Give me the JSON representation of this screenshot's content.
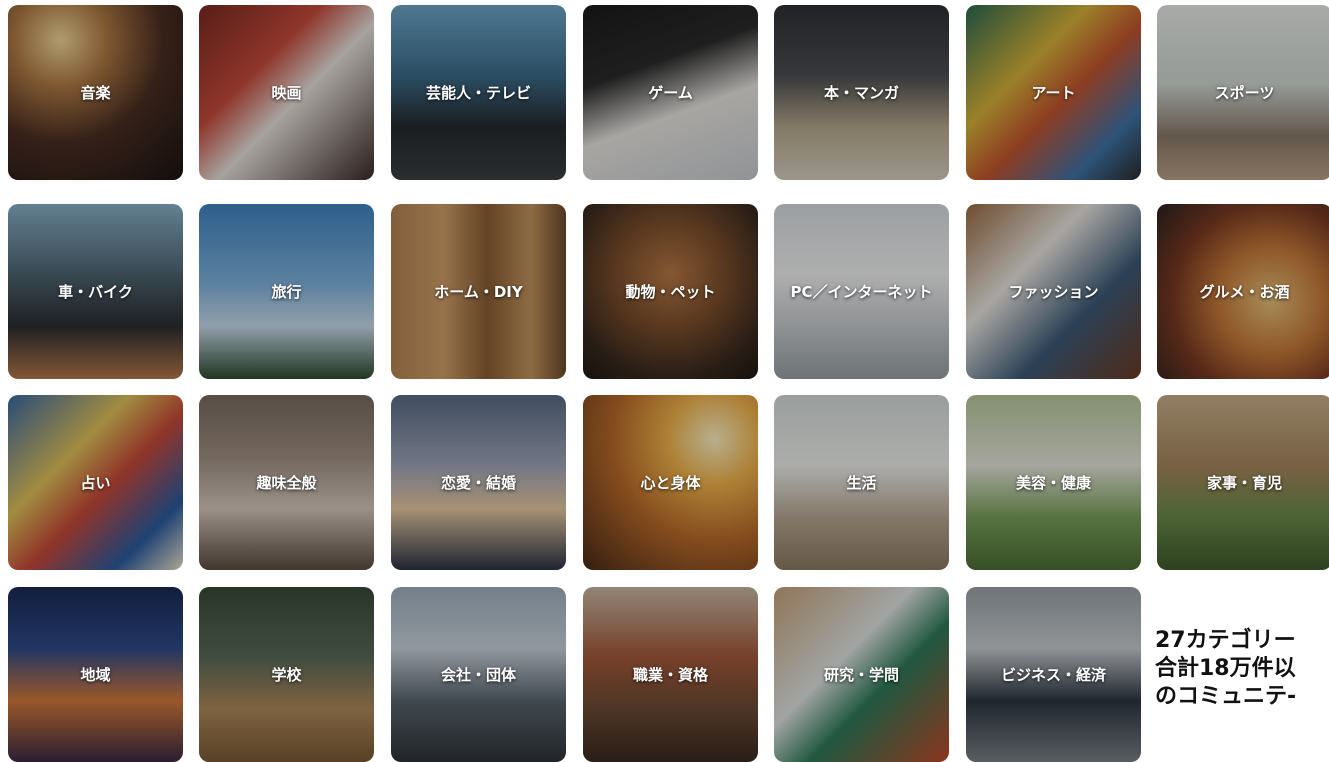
{
  "categories": [
    {
      "label": "音楽",
      "bg": "radial-gradient(circle at 30% 20%, #f3d89a 0%, #b07a45 25%, #4a2e22 55%, #1a1412 100%)"
    },
    {
      "label": "映画",
      "bg": "linear-gradient(135deg, #7a2a22 0%, #c64a3a 35%, #e8e2dc 55%, #3b2a26 100%)"
    },
    {
      "label": "芸能人・テレビ",
      "bg": "linear-gradient(180deg, #6ea7c9 0%, #3d6d8c 40%, #262a2e 70%, #3c3f42 100%)"
    },
    {
      "label": "ゲーム",
      "bg": "linear-gradient(160deg, #1b1b1b 0%, #2b2b2b 35%, #e8e6e2 60%, #c9ccd0 100%)"
    },
    {
      "label": "本・マンガ",
      "bg": "linear-gradient(180deg, #2e3034 0%, #4b4e52 40%, #b9a98c 70%, #d7d0c4 100%)"
    },
    {
      "label": "アート",
      "bg": "linear-gradient(135deg, #2a6b52 0%, #d7b33a 35%, #c5552f 55%, #3f73a7 80%, #2b2b2b 100%)"
    },
    {
      "label": "スポーツ",
      "bg": "linear-gradient(180deg, #e9ece9 0%, #cfd7d2 45%, #8a7a6a 75%, #bda38a 100%)"
    },
    {
      "label": "車・バイク",
      "bg": "linear-gradient(180deg, #8bb2c9 0%, #4f6673 40%, #2c2d30 70%, #b77a4b 100%)"
    },
    {
      "label": "旅行",
      "bg": "linear-gradient(180deg, #3f84c2 0%, #7fb3dd 45%, #c9dcec 70%, #2d4c2f 100%)"
    },
    {
      "label": "ホーム・DIY",
      "bg": "linear-gradient(90deg, #b58553 0%, #d2a06a 30%, #8a5e35 55%, #c4965f 80%, #6d4a2b 100%)"
    },
    {
      "label": "動物・ペット",
      "bg": "radial-gradient(circle at 50% 40%, #b87a45 0%, #7b4e2c 40%, #3a2a1f 75%, #1e1813 100%)"
    },
    {
      "label": "PC／インターネット",
      "bg": "linear-gradient(180deg, #d9dde0 0%, #f2f2f2 40%, #c6cacd 70%, #98a0a5 100%)"
    },
    {
      "label": "ファッション",
      "bg": "linear-gradient(135deg, #9b6b42 0%, #e9e6e0 35%, #3d5b78 65%, #6d3b22 100%)"
    },
    {
      "label": "グルメ・お酒",
      "bg": "radial-gradient(circle at 65% 55%, #e8c27a 0%, #c77a3a 35%, #7a3a22 65%, #2b2220 100%)"
    },
    {
      "label": "占い",
      "bg": "linear-gradient(135deg, #3b6aa8 0%, #e0c25a 35%, #c84a3a 55%, #2b5ca0 80%, #efe6cf 100%)"
    },
    {
      "label": "趣味全般",
      "bg": "linear-gradient(180deg, #7a6b60 0%, #a08f82 35%, #d6c9bd 65%, #5b4b40 100%)"
    },
    {
      "label": "恋愛・結婚",
      "bg": "linear-gradient(180deg, #5a6c86 0%, #9fa5b8 40%, #e6c9a2 65%, #2b3446 100%)"
    },
    {
      "label": "心と身体",
      "bg": "radial-gradient(circle at 75% 25%, #fff2c4 0%, #f0b24a 25%, #b86a2a 55%, #4a2a18 100%)"
    },
    {
      "label": "生活",
      "bg": "linear-gradient(180deg, #d7dcd9 0%, #eef0ee 40%, #b8a792 70%, #8c7a65 100%)"
    },
    {
      "label": "美容・健康",
      "bg": "linear-gradient(180deg, #b7c99a 0%, #e6e6dc 40%, #7aa05a 70%, #4c6e34 100%)"
    },
    {
      "label": "家事・育児",
      "bg": "linear-gradient(180deg, #c9b08a 0%, #a8875e 40%, #6b8a4a 70%, #3f5a2c 100%)"
    },
    {
      "label": "地域",
      "bg": "linear-gradient(180deg, #1a2a55 0%, #2e4c8a 35%, #d67a3a 65%, #3a2a44 100%)"
    },
    {
      "label": "学校",
      "bg": "linear-gradient(180deg, #3a4a3a 0%, #5b6b5a 40%, #b08a5a 70%, #7a5a35 100%)"
    },
    {
      "label": "会社・団体",
      "bg": "linear-gradient(180deg, #9fb0c0 0%, #c9d3dc 35%, #5b6670 65%, #2e3338 100%)"
    },
    {
      "label": "職業・資格",
      "bg": "linear-gradient(180deg, #c9b9a5 0%, #a55a3a 40%, #6b4a35 70%, #3a2a22 100%)"
    },
    {
      "label": "研究・学問",
      "bg": "linear-gradient(135deg, #c9a27a 0%, #e0e4e2 40%, #2e7a5a 60%, #c24a2a 100%)"
    },
    {
      "label": "ビジネス・経済",
      "bg": "linear-gradient(180deg, #9aa2a8 0%, #c8cdd0 35%, #2e3642 65%, #7b8288 100%)"
    }
  ],
  "promo": {
    "line1": "27カテゴリー",
    "line2": "合計18万件以",
    "line3": "のコミュニテ-"
  }
}
